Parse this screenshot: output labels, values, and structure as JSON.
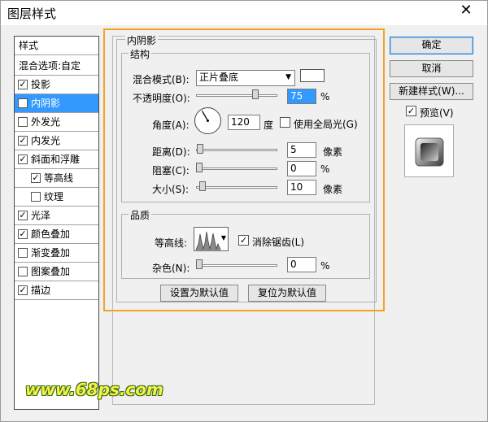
{
  "window": {
    "title": "图层样式",
    "close_symbol": "✕"
  },
  "style_list": {
    "header": "样式",
    "blend_options": "混合选项:自定",
    "items": [
      {
        "label": "投影",
        "checked": true,
        "sub": false,
        "selected": false
      },
      {
        "label": "内阴影",
        "checked": true,
        "sub": false,
        "selected": true
      },
      {
        "label": "外发光",
        "checked": false,
        "sub": false,
        "selected": false
      },
      {
        "label": "内发光",
        "checked": true,
        "sub": false,
        "selected": false
      },
      {
        "label": "斜面和浮雕",
        "checked": true,
        "sub": false,
        "selected": false
      },
      {
        "label": "等高线",
        "checked": true,
        "sub": true,
        "selected": false
      },
      {
        "label": "纹理",
        "checked": false,
        "sub": true,
        "selected": false
      },
      {
        "label": "光泽",
        "checked": true,
        "sub": false,
        "selected": false
      },
      {
        "label": "颜色叠加",
        "checked": true,
        "sub": false,
        "selected": false
      },
      {
        "label": "渐变叠加",
        "checked": false,
        "sub": false,
        "selected": false
      },
      {
        "label": "图案叠加",
        "checked": false,
        "sub": false,
        "selected": false
      },
      {
        "label": "描边",
        "checked": true,
        "sub": false,
        "selected": false
      }
    ]
  },
  "inner_shadow": {
    "title": "内阴影",
    "structure": {
      "title": "结构",
      "blend_mode_label": "混合模式(B):",
      "blend_mode_value": "正片叠底",
      "color_swatch": "#ffffff",
      "opacity_label": "不透明度(O):",
      "opacity_value": "75",
      "opacity_unit": "%",
      "opacity_level": 0.75,
      "angle_label": "角度(A):",
      "angle_value": "120",
      "angle_unit": "度",
      "global_light_label": "使用全局光(G)",
      "global_light_checked": false,
      "distance_label": "距离(D):",
      "distance_value": "5",
      "distance_unit": "像素",
      "distance_level": 0.01,
      "choke_label": "阻塞(C):",
      "choke_value": "0",
      "choke_unit": "%",
      "choke_level": 0.0,
      "size_label": "大小(S):",
      "size_value": "10",
      "size_unit": "像素",
      "size_level": 0.04
    },
    "quality": {
      "title": "品质",
      "contour_label": "等高线:",
      "anti_alias_label": "消除锯齿(L)",
      "anti_alias_checked": true,
      "noise_label": "杂色(N):",
      "noise_value": "0",
      "noise_unit": "%",
      "noise_level": 0.0
    },
    "make_default": "设置为默认值",
    "reset_default": "复位为默认值"
  },
  "buttons": {
    "ok": "确定",
    "cancel": "取消",
    "new_style": "新建样式(W)...",
    "preview_label": "预览(V)",
    "preview_checked": true
  },
  "watermark": "www.68ps.com"
}
